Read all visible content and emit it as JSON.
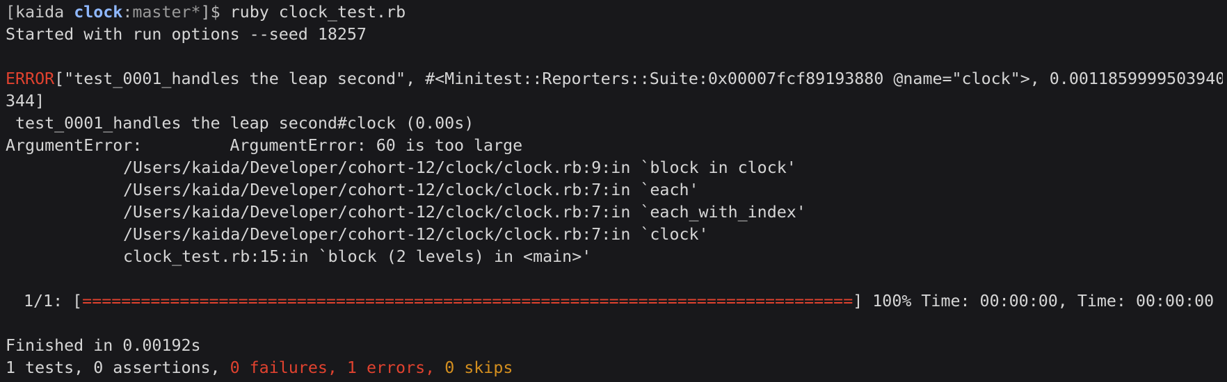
{
  "prompt": {
    "open_bracket": "[",
    "user": "kaida",
    "directory": "clock",
    "colon": ":",
    "branch": "master*",
    "close_bracket_dollar": "]$",
    "command": "ruby clock_test.rb"
  },
  "seed_line": "Started with run options --seed 18257",
  "error_block": {
    "error_label": "ERROR",
    "error_tail_line1": "[\"test_0001_handles the leap second\", #<Minitest::Reporters::Suite:0x00007fcf89193880 @name=\"clock\">, 0.0011859999503940",
    "error_tail_line2": "344]",
    "test_header": " test_0001_handles the leap second#clock (0.00s)",
    "argument_error_label": "ArgumentError:",
    "argument_error_message": "ArgumentError: 60 is too large",
    "backtrace": [
      "/Users/kaida/Developer/cohort-12/clock/clock.rb:9:in `block in clock'",
      "/Users/kaida/Developer/cohort-12/clock/clock.rb:7:in `each'",
      "/Users/kaida/Developer/cohort-12/clock/clock.rb:7:in `each_with_index'",
      "/Users/kaida/Developer/cohort-12/clock/clock.rb:7:in `clock'",
      "clock_test.rb:15:in `block (2 levels) in <main>'"
    ]
  },
  "progress": {
    "counter": "1/1: ",
    "bar_open": "[",
    "bar_fill": "===============================================================================",
    "bar_close": "]",
    "tail": " 100% Time: 00:00:00, Time: 00:00:00",
    "percent_complete": 100
  },
  "summary": {
    "finished": "Finished in 0.00192s",
    "tests_assertions": "1 tests, 0 assertions, ",
    "failures": "0 failures, ",
    "errors": "1 errors, ",
    "skips": "0 skips"
  },
  "colors": {
    "background": "#18181b",
    "foreground": "#d6d6d6",
    "directory": "#8fb8ff",
    "error_red": "#e0422f",
    "skips_orange": "#d48f1f"
  }
}
